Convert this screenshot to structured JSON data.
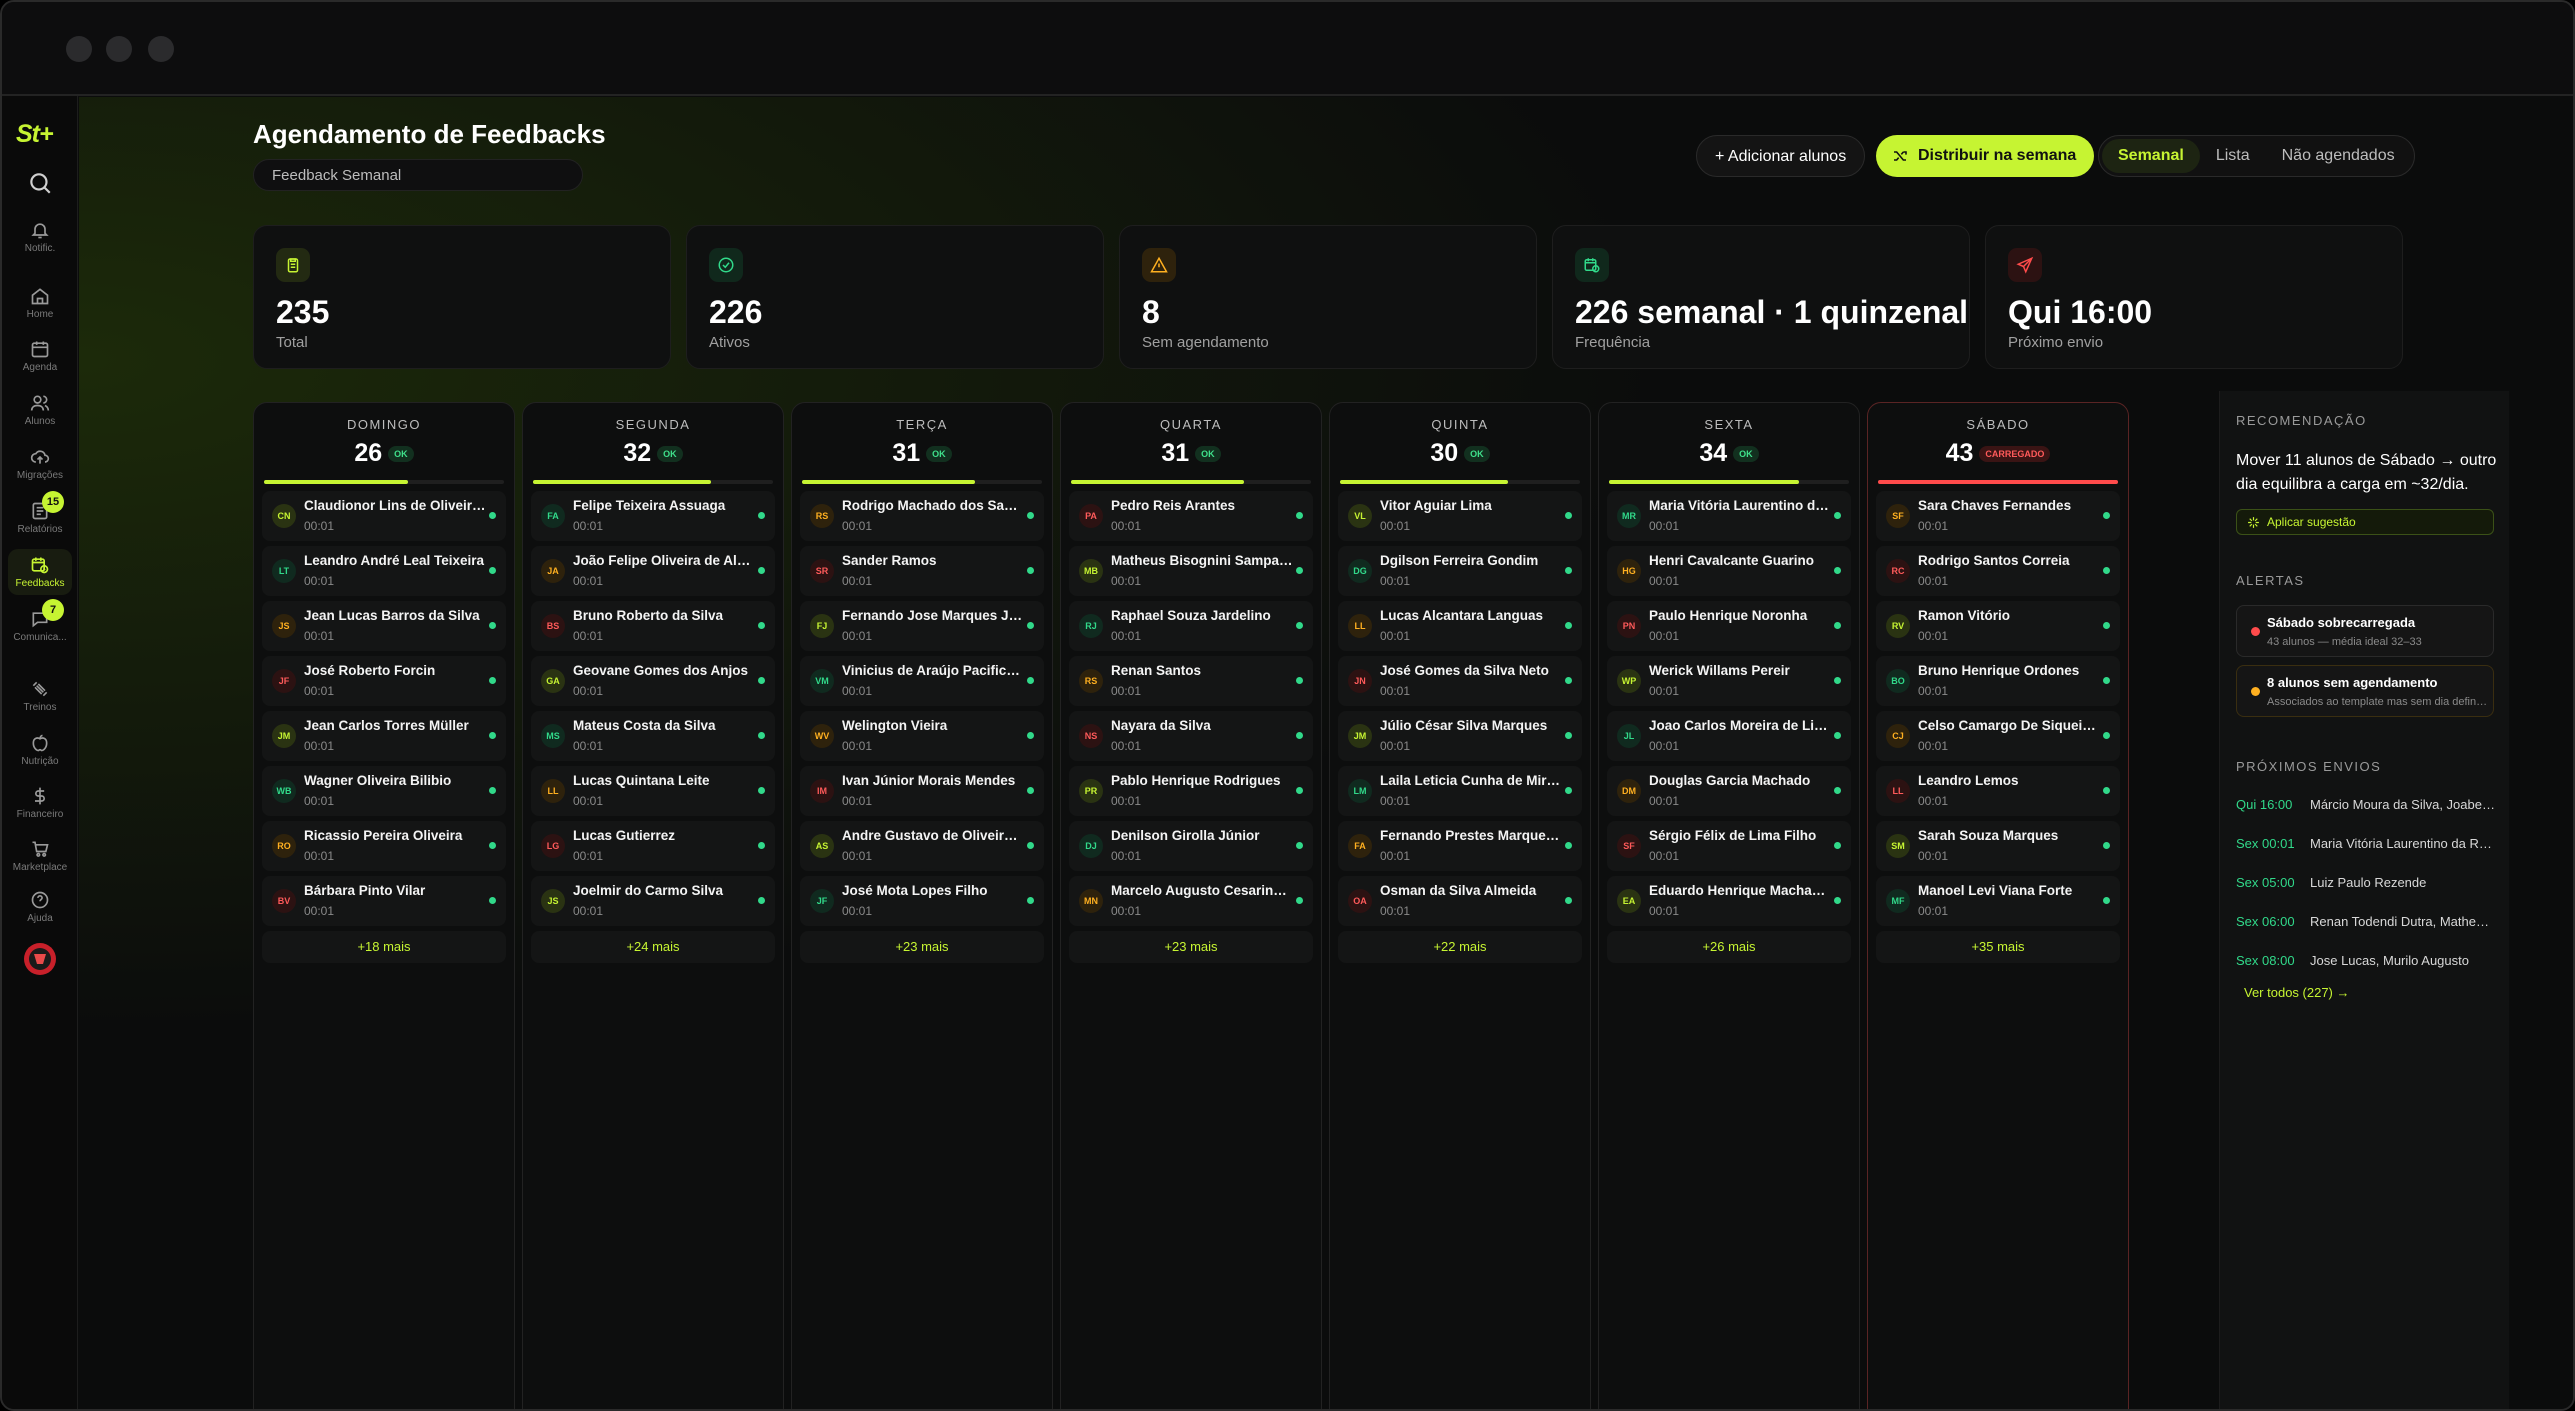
{
  "sidebar": {
    "logo": "St+",
    "items": [
      {
        "label": "",
        "icon": "search-icon"
      },
      {
        "label": "Notific.",
        "icon": "bell-icon"
      },
      {
        "label": "Home",
        "icon": "home-icon"
      },
      {
        "label": "Agenda",
        "icon": "calendar-icon"
      },
      {
        "label": "Alunos",
        "icon": "users-icon"
      },
      {
        "label": "Migrações",
        "icon": "upload-cloud-icon"
      },
      {
        "label": "Relatórios",
        "icon": "report-icon",
        "badge": "15"
      },
      {
        "label": "Feedbacks",
        "icon": "feedback-calendar-icon",
        "active": true
      },
      {
        "label": "Comunica...",
        "icon": "chat-icon",
        "badge": "7"
      },
      {
        "label": "Treinos",
        "icon": "dumbbell-icon"
      },
      {
        "label": "Nutrição",
        "icon": "apple-icon"
      },
      {
        "label": "Financeiro",
        "icon": "dollar-icon"
      },
      {
        "label": "Marketplace",
        "icon": "cart-icon"
      },
      {
        "label": "Ajuda",
        "icon": "help-icon"
      }
    ]
  },
  "header": {
    "title": "Agendamento de Feedbacks",
    "template": "Feedback Semanal",
    "add_label": "+ Adicionar alunos",
    "distribute_label": "Distribuir na semana",
    "views": [
      "Semanal",
      "Lista",
      "Não agendados"
    ],
    "active_view": "Semanal"
  },
  "stats": [
    {
      "value": "235",
      "label": "Total",
      "icon": "clipboard-icon",
      "color": "#c6f432",
      "bg": "#232a12"
    },
    {
      "value": "226",
      "label": "Ativos",
      "icon": "check-circle-icon",
      "color": "#31d98a",
      "bg": "#10281c"
    },
    {
      "value": "8",
      "label": "Sem agendamento",
      "icon": "warning-icon",
      "color": "#ffb020",
      "bg": "#2e220c"
    },
    {
      "value": "226 semanal · 1 quinzenal",
      "label": "Frequência",
      "icon": "calendar-clock-icon",
      "color": "#31d98a",
      "bg": "#10281c"
    },
    {
      "value": "Qui 16:00",
      "label": "Próximo envio",
      "icon": "send-icon",
      "color": "#ff4b4b",
      "bg": "#2c1212"
    }
  ],
  "days": [
    {
      "name": "DOMINGO",
      "count": "26",
      "status": "OK",
      "load": 0.6,
      "more": "+18 mais",
      "students": [
        {
          "initials": "CN",
          "name": "Claudionor Lins de Oliveira Neto",
          "time": "00:01"
        },
        {
          "initials": "LT",
          "name": "Leandro André Leal Teixeira",
          "time": "00:01"
        },
        {
          "initials": "JS",
          "name": "Jean Lucas Barros da Silva",
          "time": "00:01"
        },
        {
          "initials": "JF",
          "name": "José Roberto Forcin",
          "time": "00:01"
        },
        {
          "initials": "JM",
          "name": "Jean Carlos Torres Müller",
          "time": "00:01"
        },
        {
          "initials": "WB",
          "name": "Wagner Oliveira Bilibio",
          "time": "00:01"
        },
        {
          "initials": "RO",
          "name": "Ricassio Pereira Oliveira",
          "time": "00:01"
        },
        {
          "initials": "BV",
          "name": "Bárbara Pinto Vilar",
          "time": "00:01"
        }
      ]
    },
    {
      "name": "SEGUNDA",
      "count": "32",
      "status": "OK",
      "load": 0.74,
      "more": "+24 mais",
      "students": [
        {
          "initials": "FA",
          "name": "Felipe Teixeira Assuaga",
          "time": "00:01"
        },
        {
          "initials": "JA",
          "name": "João Felipe Oliveira de Almeida",
          "time": "00:01"
        },
        {
          "initials": "BS",
          "name": "Bruno Roberto da Silva",
          "time": "00:01"
        },
        {
          "initials": "GA",
          "name": "Geovane Gomes dos Anjos",
          "time": "00:01"
        },
        {
          "initials": "MS",
          "name": "Mateus Costa da Silva",
          "time": "00:01"
        },
        {
          "initials": "LL",
          "name": "Lucas Quintana Leite",
          "time": "00:01"
        },
        {
          "initials": "LG",
          "name": "Lucas Gutierrez",
          "time": "00:01"
        },
        {
          "initials": "JS",
          "name": "Joelmir do Carmo Silva",
          "time": "00:01"
        }
      ]
    },
    {
      "name": "TERÇA",
      "count": "31",
      "status": "OK",
      "load": 0.72,
      "more": "+23 mais",
      "students": [
        {
          "initials": "RS",
          "name": "Rodrigo Machado dos Santos",
          "time": "00:01"
        },
        {
          "initials": "SR",
          "name": "Sander Ramos",
          "time": "00:01"
        },
        {
          "initials": "FJ",
          "name": "Fernando Jose Marques Junior",
          "time": "00:01"
        },
        {
          "initials": "VM",
          "name": "Vinicius de Araújo Pacifico Martins",
          "time": "00:01"
        },
        {
          "initials": "WV",
          "name": "Welington Vieira",
          "time": "00:01"
        },
        {
          "initials": "IM",
          "name": "Ivan Júnior Morais Mendes",
          "time": "00:01"
        },
        {
          "initials": "AS",
          "name": "Andre Gustavo de Oliveira Silva",
          "time": "00:01"
        },
        {
          "initials": "JF",
          "name": "José Mota Lopes Filho",
          "time": "00:01"
        }
      ]
    },
    {
      "name": "QUARTA",
      "count": "31",
      "status": "OK",
      "load": 0.72,
      "more": "+23 mais",
      "students": [
        {
          "initials": "PA",
          "name": "Pedro Reis Arantes",
          "time": "00:01"
        },
        {
          "initials": "MB",
          "name": "Matheus Bisognini Sampaio Bonfim",
          "time": "00:01"
        },
        {
          "initials": "RJ",
          "name": "Raphael Souza Jardelino",
          "time": "00:01"
        },
        {
          "initials": "RS",
          "name": "Renan Santos",
          "time": "00:01"
        },
        {
          "initials": "NS",
          "name": "Nayara da Silva",
          "time": "00:01"
        },
        {
          "initials": "PR",
          "name": "Pablo Henrique Rodrigues",
          "time": "00:01"
        },
        {
          "initials": "DJ",
          "name": "Denilson Girolla Júnior",
          "time": "00:01"
        },
        {
          "initials": "MN",
          "name": "Marcelo Augusto Cesarino do Nascimento",
          "time": "00:01"
        }
      ]
    },
    {
      "name": "QUINTA",
      "count": "30",
      "status": "OK",
      "load": 0.7,
      "more": "+22 mais",
      "students": [
        {
          "initials": "VL",
          "name": "Vitor Aguiar Lima",
          "time": "00:01"
        },
        {
          "initials": "DG",
          "name": "Dgilson Ferreira Gondim",
          "time": "00:01"
        },
        {
          "initials": "LL",
          "name": "Lucas Alcantara Languas",
          "time": "00:01"
        },
        {
          "initials": "JN",
          "name": "José Gomes da Silva Neto",
          "time": "00:01"
        },
        {
          "initials": "JM",
          "name": "Júlio César Silva Marques",
          "time": "00:01"
        },
        {
          "initials": "LM",
          "name": "Laila Leticia Cunha de Miranda",
          "time": "00:01"
        },
        {
          "initials": "FA",
          "name": "Fernando Prestes Marques de Almeida",
          "time": "00:01"
        },
        {
          "initials": "OA",
          "name": "Osman da Silva Almeida",
          "time": "00:01"
        }
      ]
    },
    {
      "name": "SEXTA",
      "count": "34",
      "status": "OK",
      "load": 0.79,
      "more": "+26 mais",
      "students": [
        {
          "initials": "MR",
          "name": "Maria Vitória Laurentino da Rocha",
          "time": "00:01"
        },
        {
          "initials": "HG",
          "name": "Henri Cavalcante Guarino",
          "time": "00:01"
        },
        {
          "initials": "PN",
          "name": "Paulo Henrique Noronha",
          "time": "00:01"
        },
        {
          "initials": "WP",
          "name": "Werick Willams Pereir",
          "time": "00:01"
        },
        {
          "initials": "JL",
          "name": "Joao Carlos Moreira de Lima",
          "time": "00:01"
        },
        {
          "initials": "DM",
          "name": "Douglas Garcia Machado",
          "time": "00:01"
        },
        {
          "initials": "SF",
          "name": "Sérgio Félix de Lima Filho",
          "time": "00:01"
        },
        {
          "initials": "EA",
          "name": "Eduardo Henrique Machado Almeida",
          "time": "00:01"
        }
      ]
    },
    {
      "name": "SÁBADO",
      "count": "43",
      "status": "CARREGADO",
      "load": 1.0,
      "more": "+35 mais",
      "students": [
        {
          "initials": "SF",
          "name": "Sara Chaves Fernandes",
          "time": "00:01"
        },
        {
          "initials": "RC",
          "name": "Rodrigo Santos Correia",
          "time": "00:01"
        },
        {
          "initials": "RV",
          "name": "Ramon Vitório",
          "time": "00:01"
        },
        {
          "initials": "BO",
          "name": "Bruno Henrique Ordones",
          "time": "00:01"
        },
        {
          "initials": "CJ",
          "name": "Celso Camargo De Siqueira Junior",
          "time": "00:01"
        },
        {
          "initials": "LL",
          "name": "Leandro Lemos",
          "time": "00:01"
        },
        {
          "initials": "SM",
          "name": "Sarah Souza Marques",
          "time": "00:01"
        },
        {
          "initials": "MF",
          "name": "Manoel Levi Viana Forte",
          "time": "00:01"
        }
      ]
    }
  ],
  "panel": {
    "recommend_title": "RECOMENDAÇÃO",
    "recommend_text": "Mover 11 alunos de Sábado → outro dia equilibra a carga em ~32/dia.",
    "apply_label": "Aplicar sugestão",
    "alerts_title": "ALERTAS",
    "alerts": [
      {
        "title": "Sábado sobrecarregada",
        "sub": "43 alunos — média ideal 32–33",
        "color": "#ff4b4b"
      },
      {
        "title": "8 alunos sem agendamento",
        "sub": "Associados ao template mas sem dia definido",
        "color": "#ffb020"
      }
    ],
    "next_title": "PRÓXIMOS ENVIOS",
    "next": [
      {
        "time": "Qui 16:00",
        "names": "Márcio Moura da Silva, Joabe de Souza"
      },
      {
        "time": "Sex 00:01",
        "names": "Maria Vitória Laurentino da Rocha"
      },
      {
        "time": "Sex 05:00",
        "names": "Luiz Paulo Rezende"
      },
      {
        "time": "Sex 06:00",
        "names": "Renan Todendi Dutra, Matheus Silva"
      },
      {
        "time": "Sex 08:00",
        "names": "Jose Lucas, Murilo Augusto"
      }
    ],
    "view_all": "Ver todos (227) →"
  }
}
